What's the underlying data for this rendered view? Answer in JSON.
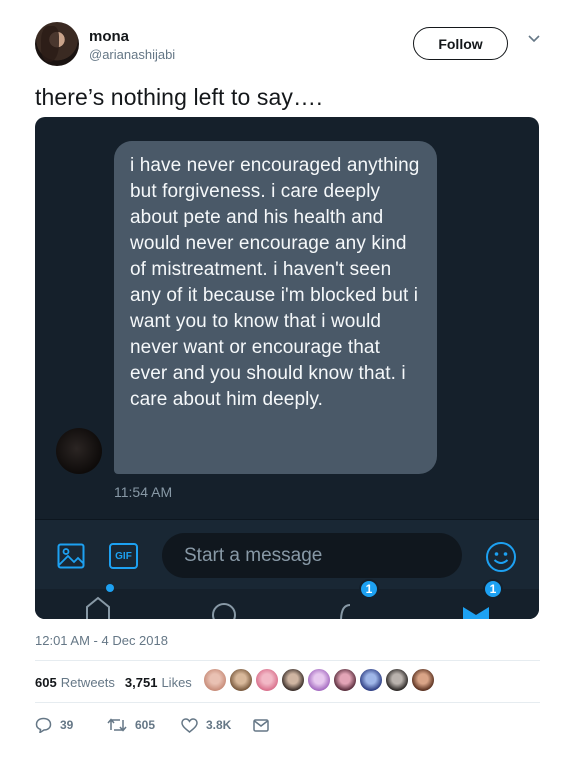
{
  "author": {
    "name": "mona",
    "handle": "@arianashijabi",
    "follow_label": "Follow"
  },
  "tweet": {
    "text": "there’s nothing left to say….",
    "timestamp": "12:01 AM - 4 Dec 2018"
  },
  "screenshot": {
    "message": "i have never encouraged anything but forgiveness. i care deeply about pete and his health and would never encourage any kind of mistreatment. i haven't seen any of it because i'm blocked but i want you to know that i would never want or encourage that ever and you should know that. i care about him deeply.",
    "message_time": "11:54 AM",
    "composer_placeholder": "Start a message",
    "gif_label": "GIF",
    "badges": [
      "1",
      "1"
    ]
  },
  "stats": {
    "retweets_count": "605",
    "retweets_label": "Retweets",
    "likes_count": "3,751",
    "likes_label": "Likes"
  },
  "actions": {
    "replies": "39",
    "retweets": "605",
    "likes": "3.8K"
  },
  "colors": {
    "accent": "#1da1f2",
    "dm_background": "#15202b",
    "bubble": "#4a5968"
  }
}
